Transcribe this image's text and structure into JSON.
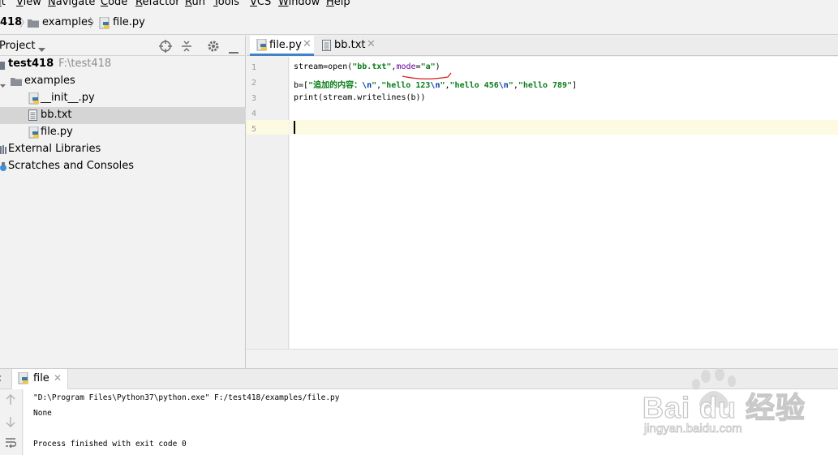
{
  "menu": [
    "it",
    "View",
    "Navigate",
    "Code",
    "Refactor",
    "Run",
    "Tools",
    "VCS",
    "Window",
    "Help"
  ],
  "breadcrumb": {
    "project": "418",
    "folder": "examples",
    "file": "file.py"
  },
  "project_panel": {
    "title": "Project",
    "root_name": "test418",
    "root_path": "F:\\test418",
    "folder": "examples",
    "files": [
      "__init__.py",
      "bb.txt",
      "file.py"
    ],
    "external_libraries": "External Libraries",
    "scratches": "Scratches and Consoles"
  },
  "editor": {
    "tabs": [
      "file.py",
      "bb.txt"
    ],
    "line_numbers": [
      "1",
      "2",
      "3",
      "4",
      "5"
    ],
    "line1": {
      "a": "stream=open(",
      "s1": "\"bb.txt\"",
      "b": ",",
      "kw": "mode",
      "eq": "=",
      "s2": "\"a\"",
      "c": ")"
    },
    "line2": {
      "a": "b=[",
      "s1": "\"追加的内容：",
      "e1": "\\n",
      "q1": "\"",
      "comma1": ",",
      "s2": "\"hello 123",
      "e2": "\\n",
      "q2": "\"",
      "comma2": ",",
      "s3": "\"hello 456",
      "e3": "\\n",
      "q3": "\"",
      "comma3": ",",
      "s4": "\"hello 789\"",
      "c": "]"
    },
    "line3": "print(stream.writelines(b))"
  },
  "run": {
    "tab_label": "file",
    "output": [
      "\"D:\\Program Files\\Python37\\python.exe\" F:/test418/examples/file.py",
      "None",
      "",
      "Process finished with exit code 0"
    ]
  },
  "watermark": {
    "brand": "Bai du 经验",
    "url": "jingyan.baidu.com"
  },
  "colors": {
    "accent": "#4083c9",
    "string": "#067d17",
    "keyword": "#660099",
    "escape": "#0037a6",
    "selection": "#d5d5d5",
    "caret_line": "#fcfae1"
  }
}
